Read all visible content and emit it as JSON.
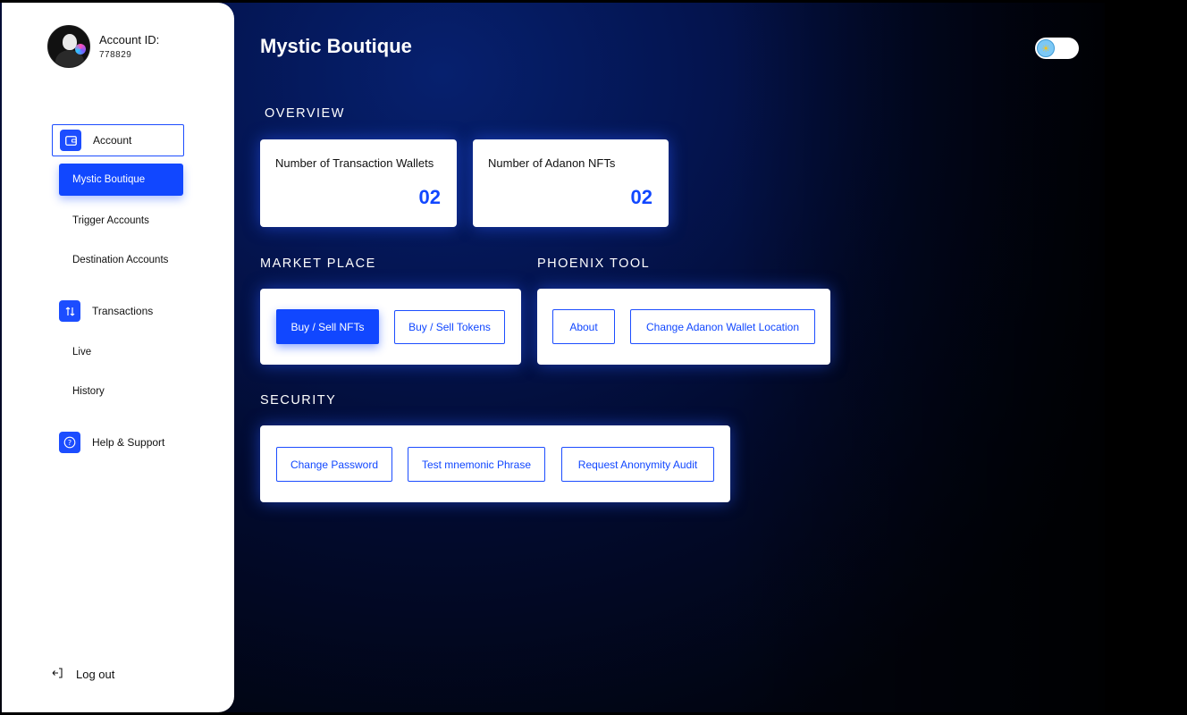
{
  "profile": {
    "account_label": "Account ID:",
    "account_id": "778829",
    "avatar_icon": "anonymous-avatar-icon"
  },
  "sidebar": {
    "account": {
      "label": "Account",
      "icon": "wallet-icon"
    },
    "account_items": [
      {
        "label": "Mystic Boutique",
        "active": true
      },
      {
        "label": "Trigger Accounts"
      },
      {
        "label": "Destination Accounts"
      }
    ],
    "transactions": {
      "label": "Transactions",
      "icon": "transfer-arrows-icon"
    },
    "transaction_items": [
      {
        "label": "Live"
      },
      {
        "label": "History"
      }
    ],
    "help": {
      "label": "Help & Support",
      "icon": "question-icon"
    },
    "logout": {
      "label": "Log out",
      "icon": "logout-icon"
    }
  },
  "header": {
    "title": "Mystic Boutique",
    "theme_toggle_icon": "sun-cloud-icon"
  },
  "overview": {
    "title": "OVERVIEW",
    "stats": [
      {
        "label": "Number of Transaction Wallets",
        "value": "02"
      },
      {
        "label": "Number of Adanon NFTs",
        "value": "02"
      }
    ]
  },
  "market_place": {
    "title": "MARKET PLACE",
    "buttons": [
      {
        "label": "Buy / Sell NFTs",
        "primary": true
      },
      {
        "label": "Buy / Sell Tokens"
      }
    ]
  },
  "phoenix_tool": {
    "title": "PHOENIX TOOL",
    "buttons": [
      {
        "label": "About"
      },
      {
        "label": "Change Adanon Wallet Location"
      }
    ]
  },
  "security": {
    "title": "SECURITY",
    "buttons": [
      {
        "label": "Change Password"
      },
      {
        "label": "Test mnemonic Phrase"
      },
      {
        "label": "Request Anonymity Audit"
      }
    ]
  },
  "colors": {
    "accent": "#1147ff",
    "background_dark": "#041552",
    "card": "#ffffff"
  }
}
